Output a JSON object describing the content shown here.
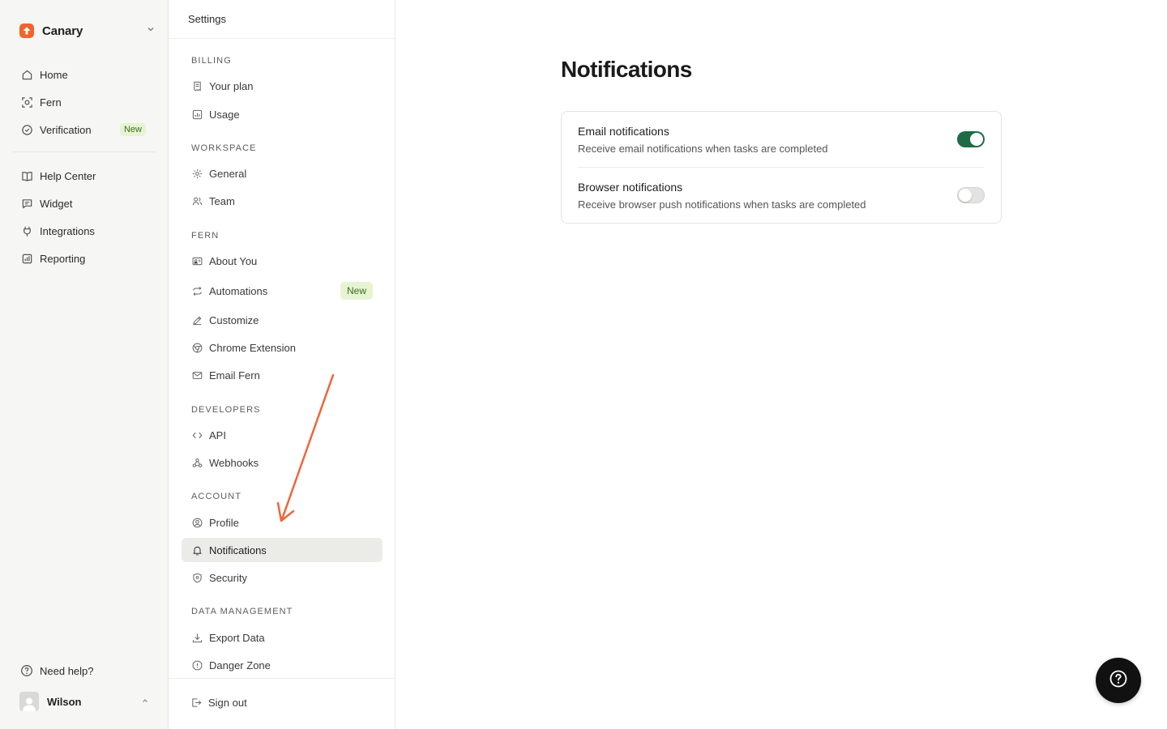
{
  "brand": {
    "name": "Canary"
  },
  "primary_nav": [
    {
      "label": "Home",
      "icon": "home-icon"
    },
    {
      "label": "Fern",
      "icon": "fern-icon"
    },
    {
      "label": "Verification",
      "icon": "check-circle-icon",
      "badge": "New"
    },
    {
      "label": "Help Center",
      "icon": "book-icon"
    },
    {
      "label": "Widget",
      "icon": "chat-icon"
    },
    {
      "label": "Integrations",
      "icon": "plug-icon"
    },
    {
      "label": "Reporting",
      "icon": "chart-icon"
    }
  ],
  "help": {
    "label": "Need help?"
  },
  "user": {
    "name": "Wilson"
  },
  "settings": {
    "title": "Settings",
    "groups": [
      {
        "title": "BILLING",
        "items": [
          {
            "label": "Your plan"
          },
          {
            "label": "Usage"
          }
        ]
      },
      {
        "title": "WORKSPACE",
        "items": [
          {
            "label": "General"
          },
          {
            "label": "Team"
          }
        ]
      },
      {
        "title": "FERN",
        "items": [
          {
            "label": "About You"
          },
          {
            "label": "Automations",
            "badge": "New"
          },
          {
            "label": "Customize"
          },
          {
            "label": "Chrome Extension"
          },
          {
            "label": "Email Fern"
          }
        ]
      },
      {
        "title": "DEVELOPERS",
        "items": [
          {
            "label": "API"
          },
          {
            "label": "Webhooks"
          }
        ]
      },
      {
        "title": "ACCOUNT",
        "items": [
          {
            "label": "Profile"
          },
          {
            "label": "Notifications",
            "active": true
          },
          {
            "label": "Security"
          }
        ]
      },
      {
        "title": "DATA MANAGEMENT",
        "items": [
          {
            "label": "Export Data"
          },
          {
            "label": "Danger Zone"
          }
        ]
      }
    ],
    "sign_out": "Sign out"
  },
  "main": {
    "title": "Notifications",
    "rows": [
      {
        "title": "Email notifications",
        "description": "Receive email notifications when tasks are completed",
        "enabled": true
      },
      {
        "title": "Browser notifications",
        "description": "Receive browser push notifications when tasks are completed",
        "enabled": false
      }
    ]
  },
  "colors": {
    "accent": "#f0652f",
    "toggle_on": "#1f6b45",
    "annotation_arrow": "#f0653a"
  }
}
